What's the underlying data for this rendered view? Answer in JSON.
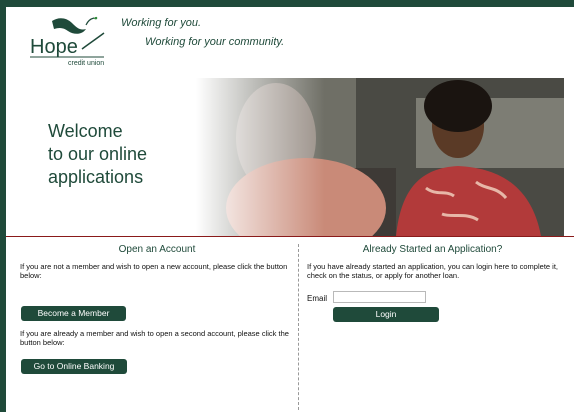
{
  "brand": {
    "logo_text": "Hope",
    "logo_subtext": "credit union",
    "tagline_line1": "Working for you.",
    "tagline_line2": "Working for your community."
  },
  "hero": {
    "welcome_lines": [
      "Welcome",
      "to our online",
      "applications"
    ]
  },
  "open_account": {
    "title": "Open an Account",
    "intro": "If you are not a member and wish to open a new account, please click the button below:",
    "become_member_label": "Become a Member",
    "second_intro": "If you are already a member and wish to open a second account, please click the button below:",
    "online_banking_label": "Go to Online Banking"
  },
  "already_started": {
    "title": "Already Started an Application?",
    "intro": "If you have already started an application, you can login here to complete it, check on the status, or apply for another loan.",
    "email_label": "Email",
    "email_value": "",
    "login_label": "Login"
  },
  "colors": {
    "brand_green": "#1f4a3a",
    "hero_rule": "#8a1a1a"
  }
}
